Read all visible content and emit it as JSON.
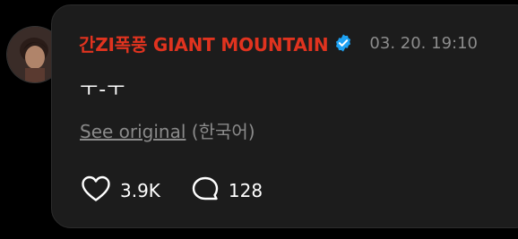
{
  "post": {
    "author": "간ZI폭풍 GIANT MOUNTAIN",
    "timestamp": "03. 20. 19:10",
    "text": "ㅜ-ㅜ",
    "translate_link": "See original",
    "translate_language": "(한국어)",
    "likes": "3.9K",
    "comments": "128"
  },
  "icons": {
    "verified": "verified-badge-icon",
    "like": "heart-icon",
    "comment": "comment-bubble-icon"
  },
  "colors": {
    "author": "#e0331f",
    "verified": "#1da1f2",
    "card_bg": "#1c1c1c",
    "muted": "#8a8a8a"
  }
}
